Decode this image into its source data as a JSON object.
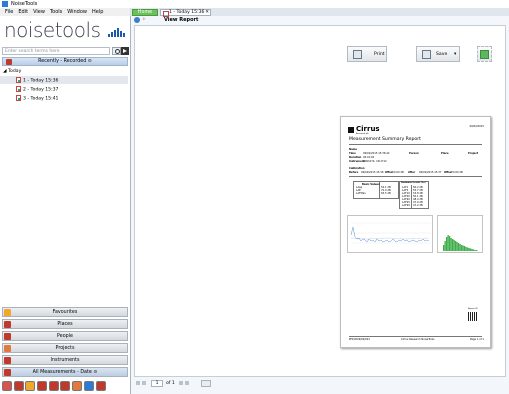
{
  "window": {
    "title": "NoiseTools"
  },
  "menu": [
    "File",
    "Edit",
    "View",
    "Tools",
    "Window",
    "Help"
  ],
  "sidebar": {
    "logo_text": "noisetools",
    "search": {
      "placeholder": "Enter search terms here",
      "value": ""
    },
    "recent_header": "Recently - Recorded",
    "tree": {
      "group": "Today",
      "items": [
        "1 - Today 15:36",
        "2 - Today 15:37",
        "3 - Today 15:41"
      ]
    },
    "nav_buttons": [
      "Favourites",
      "Places",
      "People",
      "Projects",
      "Instruments",
      "All Measurements - Date"
    ],
    "nav_icon_colors": [
      "#f0a92a",
      "#c0392b",
      "#c0392b",
      "#d35400",
      "#c0392b",
      "#c0392b"
    ]
  },
  "tabs": [
    {
      "label": "Home",
      "color": "#6bc25a"
    },
    {
      "label": "1 - Today 15:36"
    }
  ],
  "view": {
    "title": "View Report",
    "toolbar": {
      "print": "Print",
      "save": "Save"
    }
  },
  "report": {
    "date_top": "09/02/2015",
    "brand": "Cirrus",
    "brand_sub": "Research plc",
    "title": "Measurement Summary Report",
    "fields": {
      "name_label": "Name",
      "time_label": "Time",
      "time_value": "09/02/2015 15:36:42",
      "duration_label": "Duration",
      "duration_value": "00:01:00",
      "instrument_label": "Instrument",
      "instrument_value": "G000174, CR:171C",
      "person_label": "Person",
      "place_label": "Place",
      "project_label": "Project"
    },
    "calibration": {
      "label": "Calibration",
      "before_label": "Before",
      "before_value": "09/02/2015 15:36",
      "offset_label": "Offset",
      "offset_value": "0.00 dB",
      "after_label": "After",
      "after_value": "09/02/2015 15:37"
    },
    "basic_values": {
      "title": "Basic Values",
      "rows": [
        [
          "LAeq",
          "52.1 dB"
        ],
        [
          "LAE",
          "70.0 dB"
        ],
        [
          "LAFMax",
          "65.5 dB"
        ]
      ]
    },
    "stat_levels": {
      "title": "Statistical Levels (Ln)",
      "rows": [
        [
          "LAF1",
          "60.2 dB"
        ],
        [
          "LAF5",
          "55.7 dB"
        ],
        [
          "LAF10",
          "53.8 dB"
        ],
        [
          "LAF50",
          "50.1 dB"
        ],
        [
          "LAF90",
          "48.4 dB"
        ],
        [
          "LAF95",
          "47.9 dB"
        ],
        [
          "LAF99",
          "47.2 dB"
        ]
      ]
    },
    "footer_left": "PHI/2009/09/001",
    "footer_mid": "Cirrus Research NoiseTools",
    "footer_right": "Page 1 of 1",
    "qr_caption": "Report ID"
  },
  "pager": {
    "page": "1",
    "of_label": "of 1"
  }
}
